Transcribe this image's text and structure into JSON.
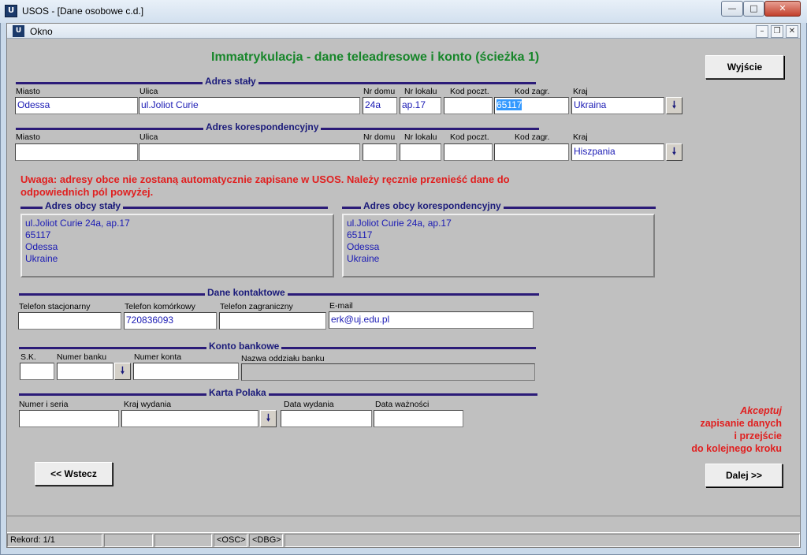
{
  "window": {
    "app_icon": "usos-app-icon",
    "title": "USOS - [Dane osobowe c.d.]",
    "min": "—",
    "max": "□",
    "close": "✕"
  },
  "inner_window": {
    "title": "Okno",
    "min": "–",
    "restore": "❐",
    "close": "✕"
  },
  "form": {
    "title": "Immatrykulacja - dane teleadresowe i konto (ścieżka 1)",
    "exit_button": "Wyjście",
    "permanent_address": {
      "section": "Adres stały",
      "labels": {
        "city": "Miasto",
        "street": "Ulica",
        "house": "Nr domu",
        "flat": "Nr lokalu",
        "postal": "Kod poczt.",
        "foreign_postal": "Kod zagr.",
        "country": "Kraj"
      },
      "values": {
        "city": "Odessa",
        "street": "ul.Joliot Curie",
        "house": "24a",
        "flat": "ap.17",
        "postal": "",
        "foreign_postal": "65117",
        "country": "Ukraina"
      }
    },
    "correspondence_address": {
      "section": "Adres korespondencyjny",
      "labels": {
        "city": "Miasto",
        "street": "Ulica",
        "house": "Nr domu",
        "flat": "Nr lokalu",
        "postal": "Kod poczt.",
        "foreign_postal": "Kod zagr.",
        "country": "Kraj"
      },
      "values": {
        "city": "",
        "street": "",
        "house": "",
        "flat": "",
        "postal": "",
        "foreign_postal": "",
        "country": "Hiszpania"
      }
    },
    "warning": "Uwaga: adresy obce nie zostaną automatycznie zapisane w USOS. Należy ręcznie przenieść dane do odpowiednich pól powyżej.",
    "foreign_permanent": {
      "section": "Adres obcy stały",
      "lines": [
        "ul.Joliot Curie 24a, ap.17",
        "65117",
        "Odessa",
        "Ukraine"
      ]
    },
    "foreign_correspondence": {
      "section": "Adres obcy korespondencyjny",
      "lines": [
        "ul.Joliot Curie 24a, ap.17",
        "65117",
        "Odessa",
        "Ukraine"
      ]
    },
    "contact": {
      "section": "Dane kontaktowe",
      "labels": {
        "landline": "Telefon stacjonarny",
        "mobile": "Telefon komórkowy",
        "foreign_phone": "Telefon zagraniczny",
        "email": "E-mail"
      },
      "values": {
        "landline": "",
        "mobile": "720836093",
        "foreign_phone": "",
        "email": "erk@uj.edu.pl"
      }
    },
    "bank": {
      "section": "Konto bankowe",
      "labels": {
        "sk": "S.K.",
        "bank_number": "Numer banku",
        "account": "Numer konta",
        "branch": "Nazwa oddziału banku"
      },
      "values": {
        "sk": "",
        "bank_number": "",
        "account": "",
        "branch": ""
      }
    },
    "polish_card": {
      "section": "Karta Polaka",
      "labels": {
        "number": "Numer i seria",
        "issuing_country": "Kraj wydania",
        "issue_date": "Data wydania",
        "expiry_date": "Data ważności"
      },
      "values": {
        "number": "",
        "issuing_country": "",
        "issue_date": "",
        "expiry_date": ""
      }
    },
    "dropdown_icon": "🠗",
    "back_button": "<< Wstecz",
    "next_button": "Dalej >>",
    "accept_note": {
      "line1": "Akceptuj",
      "line2": "zapisanie danych",
      "line3": "i przejście",
      "line4": "do kolejnego kroku"
    }
  },
  "status_bar": {
    "record": "Rekord: 1/1",
    "cell2": "",
    "cell3": "",
    "osc": "<OSC>",
    "dbg": "<DBG>"
  }
}
